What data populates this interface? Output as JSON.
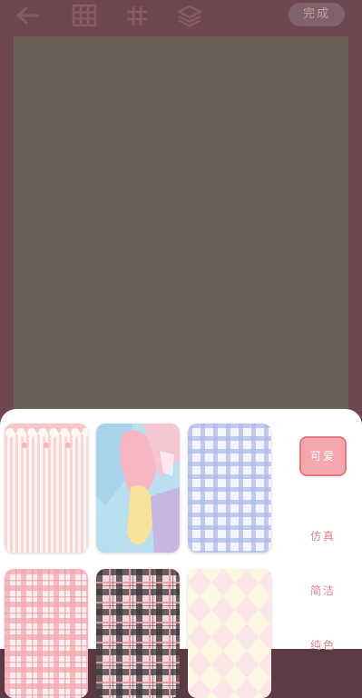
{
  "toolbar": {
    "icons": [
      "back-arrow-icon",
      "grid-icon",
      "hash-grid-icon",
      "layers-icon"
    ],
    "done_label": "完成"
  },
  "background_panel": {
    "tiles": [
      {
        "name": "pink-stripes-pattern"
      },
      {
        "name": "pastel-paint-pattern"
      },
      {
        "name": "blue-gingham-pattern"
      },
      {
        "name": "pink-plaid-pattern"
      },
      {
        "name": "black-pink-plaid-pattern"
      },
      {
        "name": "yellow-harlequin-pattern"
      }
    ],
    "categories": [
      {
        "label": "可爱",
        "active": true
      },
      {
        "label": "仿真",
        "active": false
      },
      {
        "label": "简洁",
        "active": false
      },
      {
        "label": "纯色",
        "active": false
      }
    ]
  },
  "colors": {
    "overlay": "#5e3b44",
    "canvas": "#6b6158",
    "accent": "#f5a7ad",
    "category_text": "#d98a90"
  }
}
